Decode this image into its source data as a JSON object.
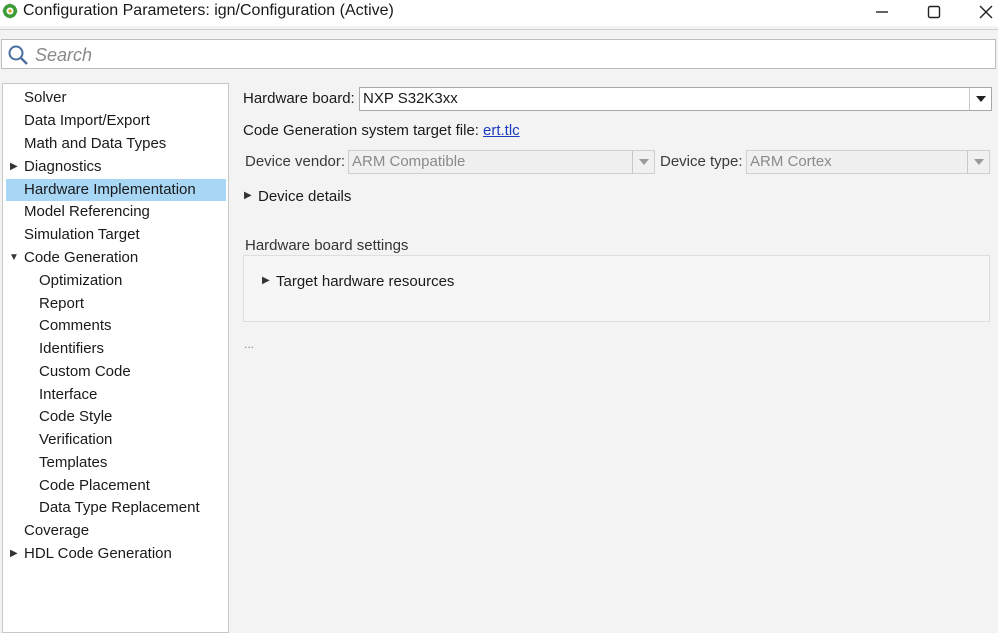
{
  "window": {
    "title": "Configuration Parameters: ign/Configuration (Active)",
    "icon": "simulink-gear-icon"
  },
  "search": {
    "placeholder": "Search",
    "value": ""
  },
  "sidebar": {
    "items": [
      {
        "label": "Solver"
      },
      {
        "label": "Data Import/Export"
      },
      {
        "label": "Math and Data Types"
      },
      {
        "label": "Diagnostics",
        "expander": "collapsed"
      },
      {
        "label": "Hardware Implementation",
        "selected": true
      },
      {
        "label": "Model Referencing"
      },
      {
        "label": "Simulation Target"
      },
      {
        "label": "Code Generation",
        "expander": "expanded"
      },
      {
        "label": "Optimization"
      },
      {
        "label": "Report"
      },
      {
        "label": "Comments"
      },
      {
        "label": "Identifiers"
      },
      {
        "label": "Custom Code"
      },
      {
        "label": "Interface"
      },
      {
        "label": "Code Style"
      },
      {
        "label": "Verification"
      },
      {
        "label": "Templates"
      },
      {
        "label": "Code Placement"
      },
      {
        "label": "Data Type Replacement"
      },
      {
        "label": "Coverage"
      },
      {
        "label": "HDL Code Generation",
        "expander": "collapsed"
      }
    ]
  },
  "main": {
    "hardware_board_label": "Hardware board:",
    "hardware_board_value": "NXP S32K3xx",
    "target_file_label": "Code Generation system target file:",
    "target_file_link": "ert.tlc",
    "device_vendor_label": "Device vendor:",
    "device_vendor_value": "ARM Compatible",
    "device_type_label": "Device type:",
    "device_type_value": "ARM Cortex",
    "device_details_label": "Device details",
    "board_settings_label": "Hardware board settings",
    "target_resources_label": "Target hardware resources",
    "ellipsis": "..."
  }
}
